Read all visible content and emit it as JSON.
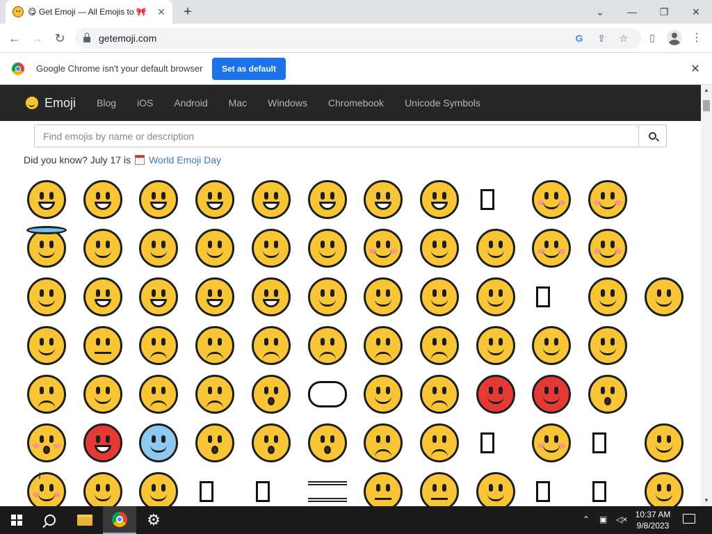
{
  "browser": {
    "tab_title": "😋 Get Emoji — All Emojis to 🎀",
    "new_tab_icon": "plus-icon",
    "url": "getemoji.com",
    "window_controls": [
      "minimize",
      "restore",
      "close"
    ]
  },
  "infobar": {
    "message": "Google Chrome isn't your default browser",
    "button": "Set as default"
  },
  "site": {
    "brand": "Emoji",
    "nav": [
      "Blog",
      "iOS",
      "Android",
      "Mac",
      "Windows",
      "Chromebook",
      "Unicode Symbols"
    ],
    "search_placeholder": "Find emojis by name or description",
    "did_you_know": "Did you know? July 17 is",
    "did_you_know_link": "World Emoji Day"
  },
  "emoji_rows": [
    [
      "😀",
      "😃",
      "😄",
      "😁",
      "😆",
      "😅",
      "😂",
      "🤣",
      "🥲",
      "☺️",
      "😊"
    ],
    [
      "😇",
      "🙂",
      "🙃",
      "😉",
      "😌",
      "😍",
      "🥰",
      "😘",
      "😗",
      "😙",
      "😚"
    ],
    [
      "😋",
      "😛",
      "😝",
      "😜",
      "🤪",
      "🤨",
      "🧐",
      "🤓",
      "😎",
      "🥸",
      "🤩",
      "🥳"
    ],
    [
      "😏",
      "😒",
      "😞",
      "😔",
      "😟",
      "😕",
      "🙁",
      "☹️",
      "😣",
      "😖",
      "😫"
    ],
    [
      "😩",
      "🥺",
      "😢",
      "😭",
      "😮",
      "💨",
      "😤",
      "😠",
      "😡",
      "🤬",
      "🤯"
    ],
    [
      "😳",
      "🥵",
      "🥶",
      "😱",
      "😨",
      "😰",
      "😥",
      "😓",
      "🫣",
      "🤗",
      "🫡",
      "🤔",
      "🫢"
    ],
    [
      "🤭",
      "🤫",
      "🤥",
      "😶",
      "😶",
      "🌫️",
      "😐",
      "😑",
      "😬",
      "🫠",
      "🫨",
      "🙄"
    ]
  ],
  "taskbar": {
    "clock_time": "10:37 AM",
    "clock_date": "9/8/2023"
  },
  "colors": {
    "site_nav_bg": "#262626",
    "accent_button": "#1a73e8",
    "link": "#3b78b8",
    "emoji_yellow": "#f8c537"
  }
}
